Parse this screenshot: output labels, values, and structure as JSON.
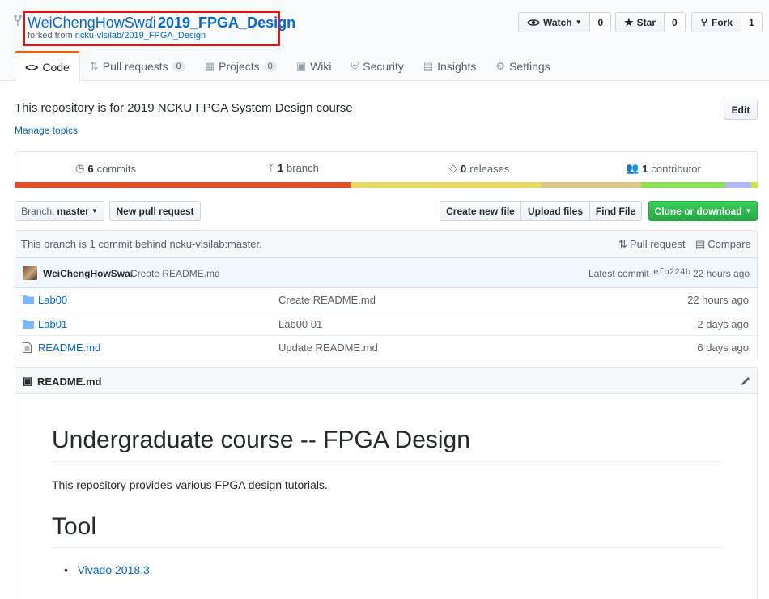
{
  "repo": {
    "owner": "WeiChengHowSwai",
    "slash": "/",
    "name": "2019_FPGA_Design",
    "forked_prefix": "forked from",
    "forked_source": "ncku-vlsilab/2019_FPGA_Design"
  },
  "actions": {
    "watch_label": "Watch",
    "watch_count": "0",
    "star_label": "Star",
    "star_count": "0",
    "fork_label": "Fork",
    "fork_count": "1"
  },
  "tabs": [
    {
      "label": "Code",
      "icon": "code-icon"
    },
    {
      "label": "Pull requests",
      "count": "0",
      "icon": "pull-request-icon"
    },
    {
      "label": "Projects",
      "count": "0",
      "icon": "project-icon"
    },
    {
      "label": "Wiki",
      "icon": "book-icon"
    },
    {
      "label": "Security",
      "icon": "shield-icon"
    },
    {
      "label": "Insights",
      "icon": "graph-icon"
    },
    {
      "label": "Settings",
      "icon": "gear-icon"
    }
  ],
  "description": "This repository is for 2019 NCKU FPGA System Design course",
  "manage_topics": "Manage topics",
  "edit_label": "Edit",
  "summary": {
    "commits_num": "6",
    "commits_label": "commits",
    "branch_num": "1",
    "branch_label": "branch",
    "releases_num": "0",
    "releases_label": "releases",
    "contributor_num": "1",
    "contributor_label": "contributor"
  },
  "lang_colors": [
    "#e34c26",
    "#e8da5d",
    "#dbc786",
    "#89e051",
    "#b2b7f8",
    "#c1f12e"
  ],
  "toolbar": {
    "branch_prefix": "Branch:",
    "branch_name": "master",
    "new_pr": "New pull request",
    "create_file": "Create new file",
    "upload_files": "Upload files",
    "find_file": "Find File",
    "clone": "Clone or download"
  },
  "behind": {
    "text": "This branch is 1 commit behind ncku-vlsilab:master.",
    "pull_request": "Pull request",
    "compare": "Compare"
  },
  "latest_commit": {
    "author": "WeiChengHowSwai",
    "message": "Create README.md",
    "prefix": "Latest commit",
    "sha": "efb224b",
    "age": "22 hours ago"
  },
  "files": [
    {
      "name": "Lab00",
      "type": "folder",
      "message": "Create README.md",
      "age": "22 hours ago"
    },
    {
      "name": "Lab01",
      "type": "folder",
      "message": "Lab00 01",
      "age": "2 days ago"
    },
    {
      "name": "README.md",
      "type": "file",
      "message": "Update README.md",
      "age": "6 days ago"
    }
  ],
  "readme": {
    "file": "README.md",
    "h1": "Undergraduate course -- FPGA Design",
    "para": "This repository provides various FPGA design tutorials.",
    "h2": "Tool",
    "item": "Vivado 2018.3"
  }
}
